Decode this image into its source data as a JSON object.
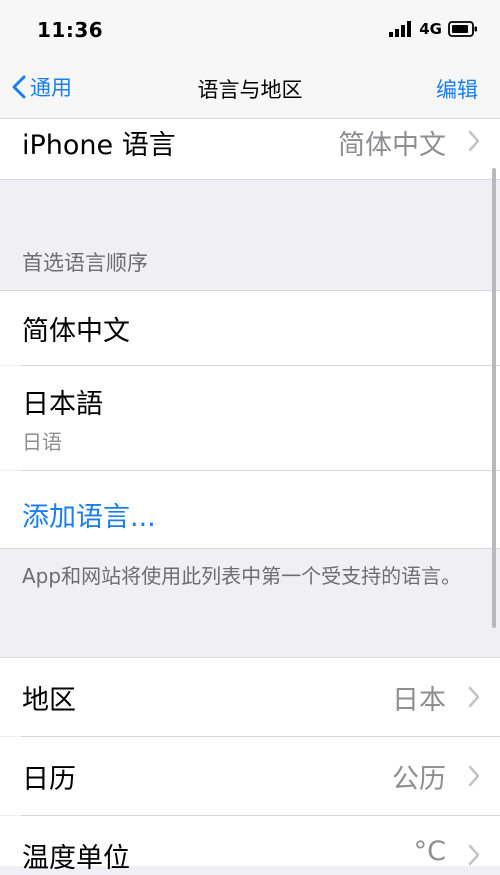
{
  "status_bar": {
    "time": "11:36",
    "network": "4G",
    "icons": [
      "signal-icon",
      "battery-icon"
    ]
  },
  "nav": {
    "back_label": "通用",
    "title": "语言与地区",
    "edit_label": "编辑"
  },
  "iphone_language": {
    "label": "iPhone 语言",
    "value": "简体中文"
  },
  "preferred_order": {
    "header": "首选语言顺序",
    "languages": [
      {
        "name": "简体中文"
      },
      {
        "name": "日本語",
        "native": "日语"
      }
    ],
    "add_label": "添加语言...",
    "footer": "App和网站将使用此列表中第一个受支持的语言。"
  },
  "region_settings": [
    {
      "label": "地区",
      "value": "日本"
    },
    {
      "label": "日历",
      "value": "公历"
    },
    {
      "label": "温度单位",
      "value": "°C"
    }
  ],
  "colors": {
    "accent": "#1a7ef2",
    "background": "#efeff4",
    "secondary_text": "#8e8e93"
  }
}
